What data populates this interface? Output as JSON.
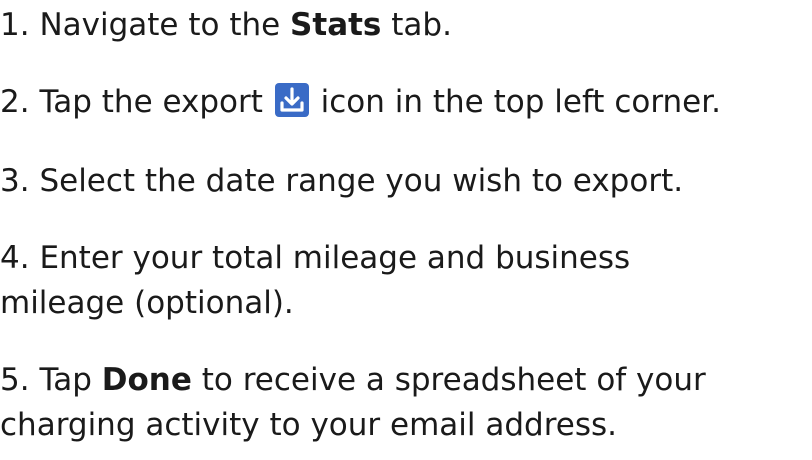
{
  "colors": {
    "text": "#1a1a1a",
    "icon_bg": "#3a6bc6"
  },
  "steps": [
    {
      "num": "1.",
      "pre": "Navigate to the ",
      "bold": "Stats",
      "post": " tab."
    },
    {
      "num": "2.",
      "pre": "Tap the export ",
      "icon": "export-download-icon",
      "post": " icon in the top left corner."
    },
    {
      "num": "3.",
      "text": "Select the date range you wish to export."
    },
    {
      "num": "4.",
      "line1": "Enter your total mileage and business",
      "line2": "mileage (optional)."
    },
    {
      "num": "5.",
      "pre": "Tap ",
      "bold": "Done",
      "line1_post": " to receive a spreadsheet of your",
      "line2": "charging activity to your email address."
    }
  ]
}
